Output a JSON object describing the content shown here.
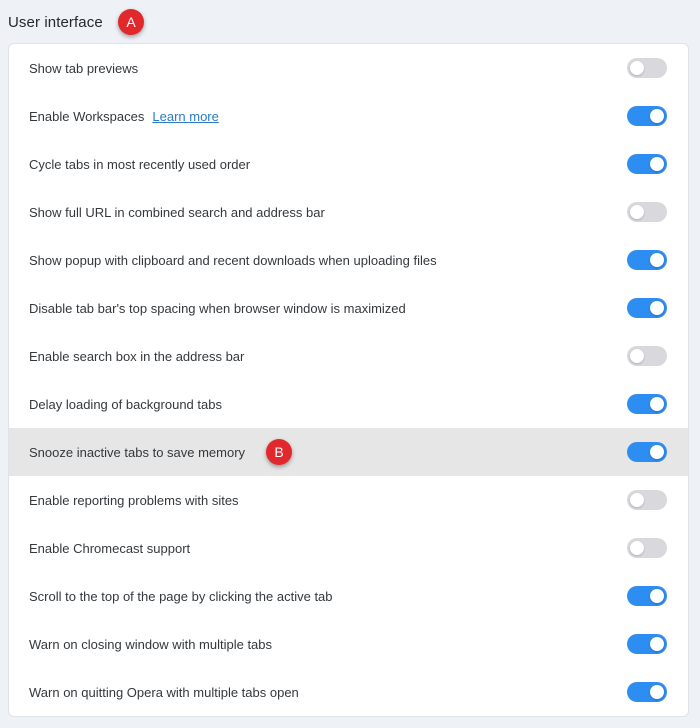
{
  "section": {
    "title": "User interface",
    "badge": "A"
  },
  "colors": {
    "toggle_on": "#2e8df0",
    "toggle_off": "#d9d9dd",
    "badge": "#e0282d",
    "link": "#2b7bc9",
    "highlight_row": "#e6e6e6"
  },
  "settings": [
    {
      "label": "Show tab previews",
      "enabled": false
    },
    {
      "label": "Enable Workspaces",
      "link": "Learn more",
      "enabled": true
    },
    {
      "label": "Cycle tabs in most recently used order",
      "enabled": true
    },
    {
      "label": "Show full URL in combined search and address bar",
      "enabled": false
    },
    {
      "label": "Show popup with clipboard and recent downloads when uploading files",
      "enabled": true
    },
    {
      "label": "Disable tab bar's top spacing when browser window is maximized",
      "enabled": true
    },
    {
      "label": "Enable search box in the address bar",
      "enabled": false
    },
    {
      "label": "Delay loading of background tabs",
      "enabled": true
    },
    {
      "label": "Snooze inactive tabs to save memory",
      "enabled": true,
      "highlighted": true,
      "badge": "B"
    },
    {
      "label": "Enable reporting problems with sites",
      "enabled": false
    },
    {
      "label": "Enable Chromecast support",
      "enabled": false
    },
    {
      "label": "Scroll to the top of the page by clicking the active tab",
      "enabled": true
    },
    {
      "label": "Warn on closing window with multiple tabs",
      "enabled": true
    },
    {
      "label": "Warn on quitting Opera with multiple tabs open",
      "enabled": true
    }
  ]
}
